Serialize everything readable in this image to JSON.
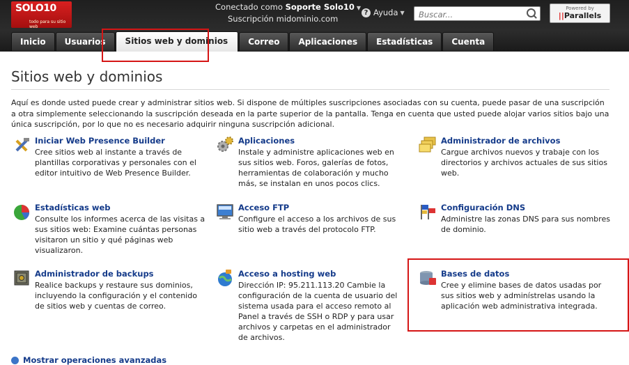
{
  "header": {
    "logo_text": "SOLO10",
    "logo_tagline": "todo para su sitio web",
    "connected_prefix": "Conectado como",
    "user": "Soporte Solo10",
    "subscription_prefix": "Suscripción",
    "subscription": "midominio.com",
    "help": "Ayuda",
    "search_placeholder": "Buscar...",
    "powered_by": "Powered by",
    "parallels": "Parallels"
  },
  "tabs": [
    "Inicio",
    "Usuarios",
    "Sitios web y dominios",
    "Correo",
    "Aplicaciones",
    "Estadísticas",
    "Cuenta"
  ],
  "active_tab": "Sitios web y dominios",
  "page": {
    "title": "Sitios web y dominios",
    "intro": "Aquí es donde usted puede crear y administrar sitios web. Si dispone de múltiples suscripciones asociadas con su cuenta, puede pasar de una suscripción a otra simplemente seleccionando la suscripción deseada en la parte superior de la pantalla. Tenga en cuenta que usted puede alojar varios sitios bajo una única suscripción, por lo que no es necesario adquirir ninguna suscripción adicional."
  },
  "tools": [
    {
      "title": "Iniciar Web Presence Builder",
      "desc": "Cree sitios web al instante a través de plantillas corporativas y personales con el editor intuitivo de Web Presence Builder.",
      "icon": "wrench-hammer-icon"
    },
    {
      "title": "Aplicaciones",
      "desc": "Instale y administre aplicaciones web en sus sitios web. Foros, galerías de fotos, herramientas de colaboración y mucho más, se instalan en unos pocos clics.",
      "icon": "gears-icon"
    },
    {
      "title": "Administrador de archivos",
      "desc": "Cargue archivos nuevos y trabaje con los directorios y archivos actuales de sus sitios web.",
      "icon": "folders-icon"
    },
    {
      "title": "Estadísticas web",
      "desc": "Consulte los informes acerca de las visitas a sus sitios web: Examine cuántas personas visitaron un sitio y qué páginas web visualizaron.",
      "icon": "pie-chart-icon"
    },
    {
      "title": "Acceso FTP",
      "desc": "Configure el acceso a los archivos de sus sitio web a través del protocolo FTP.",
      "icon": "ftp-monitor-icon"
    },
    {
      "title": "Configuración DNS",
      "desc": "Administre las zonas DNS para sus nombres de dominio.",
      "icon": "dns-flags-icon"
    },
    {
      "title": "Administrador de backups",
      "desc": "Realice backups y restaure sus dominios, incluyendo la configuración y el contenido de sitios web y cuentas de correo.",
      "icon": "safe-icon"
    },
    {
      "title": "Acceso a hosting web",
      "desc": "Dirección IP: 95.211.113.20 Cambie la configuración de la cuenta de usuario del sistema usada para el acceso remoto al Panel a través de SSH o RDP y para usar archivos y carpetas en el administrador de archivos.",
      "icon": "globe-key-icon"
    },
    {
      "title": "Bases de datos",
      "desc": "Cree y elimine bases de datos usadas por sus sitios web y adminístrelas usando la aplicación web administrativa integrada.",
      "icon": "database-icon"
    }
  ],
  "advanced_link": "Mostrar operaciones avanzadas",
  "colors": {
    "link": "#153b8a",
    "highlight": "#d51515",
    "header_bg": "#232323"
  }
}
